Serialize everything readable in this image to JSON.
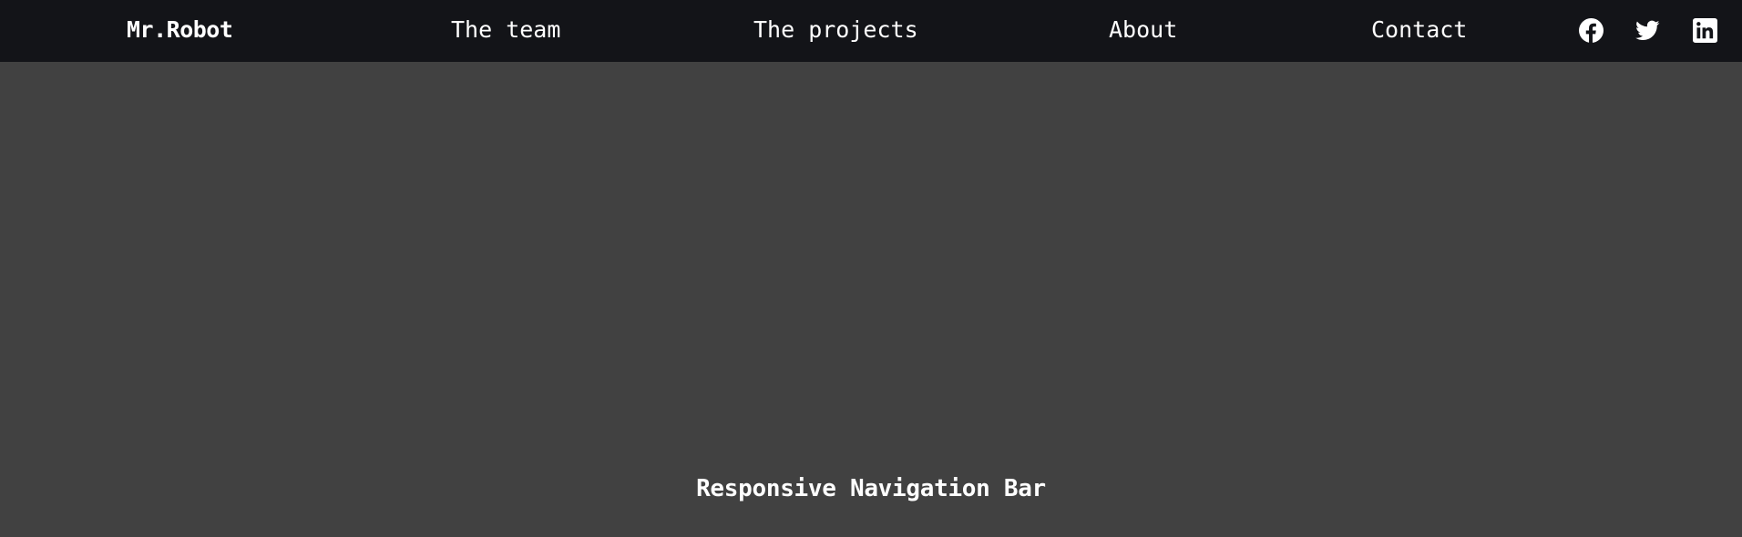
{
  "navbar": {
    "brand": "Mr.Robot",
    "links": [
      {
        "label": "The team"
      },
      {
        "label": "The projects"
      },
      {
        "label": "About"
      },
      {
        "label": "Contact"
      }
    ],
    "social": [
      {
        "icon": "facebook-icon"
      },
      {
        "icon": "twitter-icon"
      },
      {
        "icon": "linkedin-icon"
      }
    ]
  },
  "hero": {
    "title": "Responsive Navigation Bar"
  },
  "colors": {
    "navbar_bg": "#131418",
    "page_bg": "#414141",
    "text": "#ffffff"
  }
}
